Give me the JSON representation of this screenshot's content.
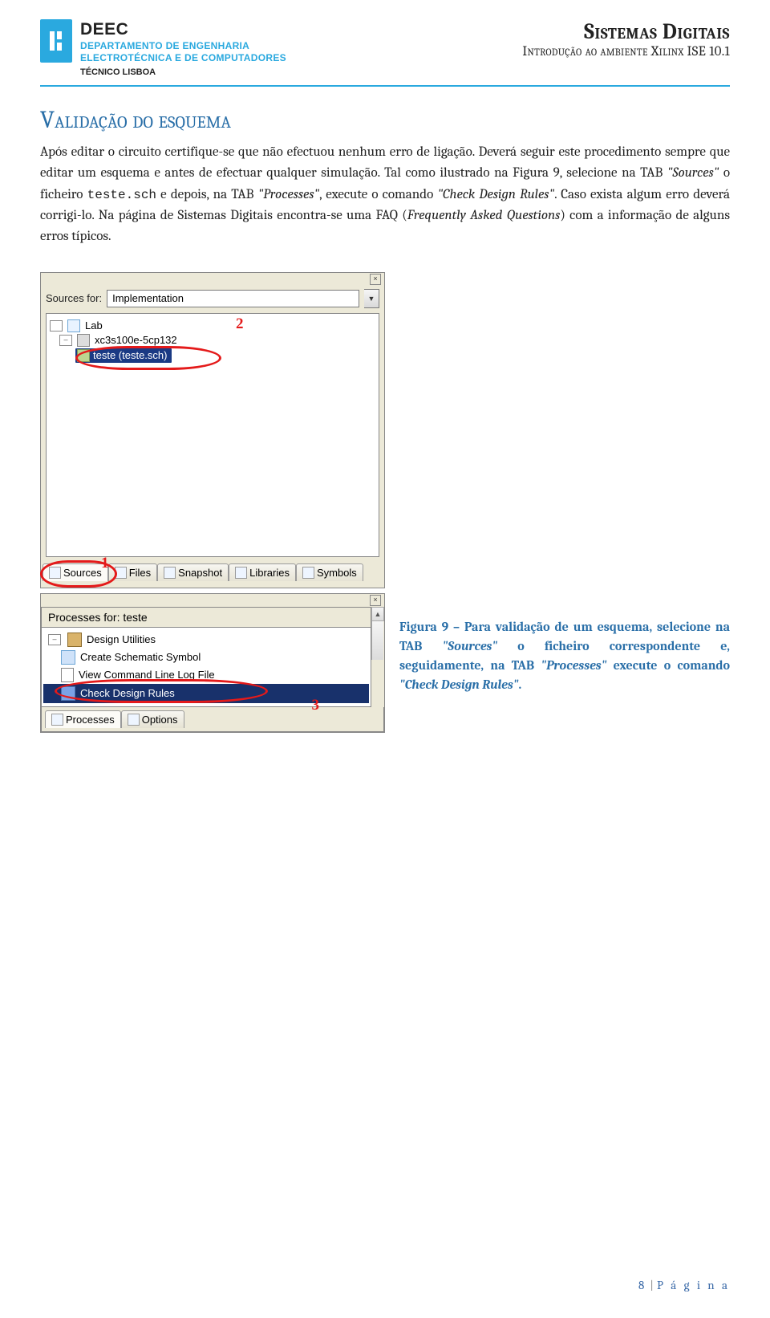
{
  "header": {
    "dept_abbr": "DEEC",
    "dept_line1": "DEPARTAMENTO DE ENGENHARIA",
    "dept_line2": "ELECTROTÉCNICA E DE COMPUTADORES",
    "dept_foot": "TÉCNICO LISBOA",
    "doc_title": "Sistemas Digitais",
    "doc_sub": "Introdução ao ambiente Xilinx ISE 10.1"
  },
  "section_title": "Validação do esquema",
  "para": {
    "p1a": "Após editar o circuito certifique-se que não efectuou nenhum erro de ligação. Deverá seguir este procedimento sempre que editar um esquema e antes de efectuar qualquer simulação.  Tal como ilustrado na Figura 9, selecione na TAB ",
    "p1b": "\"Sources\"",
    "p1c": " o ficheiro ",
    "p1d": "teste.sch",
    "p1e": " e depois, na TAB ",
    "p1f": "\"Processes\"",
    "p1g": ", execute o comando ",
    "p1h": "\"Check Design Rules\"",
    "p1i": ". Caso exista algum erro deverá corrigi-lo. Na página de Sistemas Digitais encontra-se uma FAQ (",
    "p1j": "Frequently Asked Questions",
    "p1k": ") com a informação de alguns erros típicos."
  },
  "callouts": {
    "one": "1",
    "two": "2",
    "three": "3"
  },
  "sources_pane": {
    "label": "Sources for:",
    "value": "Implementation",
    "tree": {
      "root": "Lab",
      "device": "xc3s100e-5cp132",
      "file": "teste (teste.sch)"
    },
    "tabs": {
      "sources": "Sources",
      "files": "Files",
      "snapshot": "Snapshot",
      "libraries": "Libraries",
      "symbols": "Symbols"
    }
  },
  "processes_pane": {
    "title": "Processes for:  teste",
    "rows": {
      "utilities": "Design Utilities",
      "create": "Create Schematic Symbol",
      "viewlog": "View Command Line Log File",
      "check": "Check Design Rules"
    },
    "tabs": {
      "processes": "Processes",
      "options": "Options"
    }
  },
  "caption": {
    "a": "Figura 9 – Para validação de um esquema, selecione na TAB ",
    "b": "\"Sources\"",
    "c": " o ficheiro correspondente e, seguidamente, na TAB ",
    "d": "\"Processes\"",
    "e": " execute o comando ",
    "f": "\"Check Design Rules\"",
    "g": "."
  },
  "footer": {
    "num": "8",
    "sep": "|",
    "label": "P á g i n a"
  }
}
